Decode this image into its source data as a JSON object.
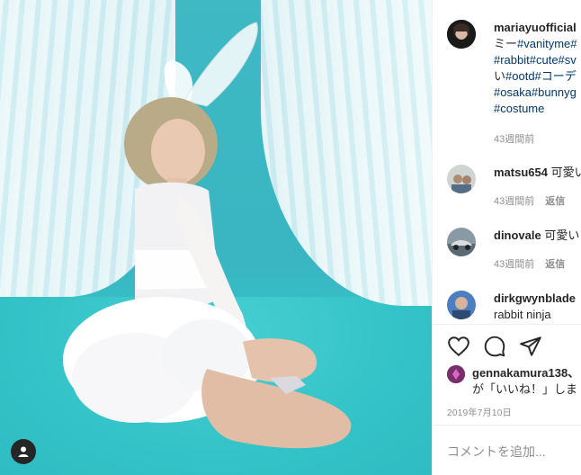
{
  "post": {
    "author": "mariayuofficial",
    "caption_lines": [
      {
        "segments": [
          {
            "t": "ミー",
            "k": "plain"
          },
          {
            "t": "#vanityme#",
            "k": "tag"
          }
        ]
      },
      {
        "segments": [
          {
            "t": "#rabbit#cute#sv",
            "k": "tag"
          }
        ]
      },
      {
        "segments": [
          {
            "t": "い",
            "k": "plain"
          },
          {
            "t": "#ootd#コーデ",
            "k": "tag"
          }
        ]
      },
      {
        "segments": [
          {
            "t": "#osaka#bunnyg",
            "k": "tag"
          }
        ]
      },
      {
        "segments": [
          {
            "t": "#costume",
            "k": "tag"
          }
        ]
      }
    ],
    "caption_time": "43週間前"
  },
  "comments": [
    {
      "user": "matsu654",
      "text": "可愛い",
      "time": "43週間前",
      "reply": "返信"
    },
    {
      "user": "dinovale",
      "text": "可愛い",
      "time": "43週間前",
      "reply": "返信"
    },
    {
      "user": "dirkgwynblade",
      "text": "rabbit ninja",
      "time": "",
      "reply": ""
    }
  ],
  "likes": {
    "user": "gennakamura138、",
    "line2": "が「いいね！」しま"
  },
  "date": "2019年7月10日",
  "add_comment_placeholder": "コメントを追加...",
  "icons": {
    "like": "heart-icon",
    "comment": "comment-bubble-icon",
    "share": "paper-plane-icon",
    "tagged": "user-tag-icon"
  },
  "colors": {
    "accent_link": "#00376b",
    "text": "#262626",
    "muted": "#8e8e8e",
    "photo_bg": "#3fb9c4"
  }
}
